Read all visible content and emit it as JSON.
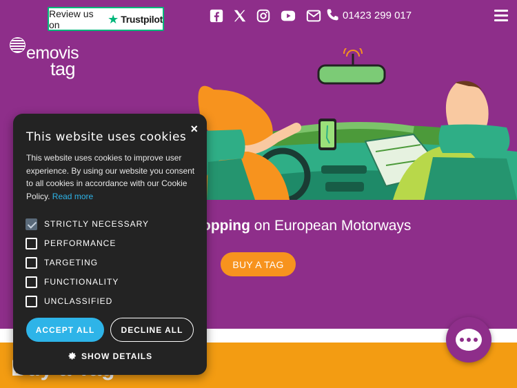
{
  "header": {
    "trustpilot": {
      "prefix": "Review us on",
      "brand": "Trustpilot"
    },
    "social_icons": [
      "facebook-icon",
      "x-icon",
      "instagram-icon",
      "youtube-icon",
      "email-icon"
    ],
    "phone": "01423 299 017"
  },
  "logo": {
    "line1": "emovis",
    "line2": "tag"
  },
  "hero": {
    "headline_bold": "topping",
    "headline_rest": " on European Motorways",
    "cta": "BUY A TAG"
  },
  "section": {
    "title": "Buy a Tag"
  },
  "cookie": {
    "title": "This website uses cookies",
    "description": "This website uses cookies to improve user experience. By using our website you consent to all cookies in accordance with our Cookie Policy.",
    "read_more": "Read more",
    "options": [
      {
        "label": "STRICTLY NECESSARY",
        "checked": true
      },
      {
        "label": "PERFORMANCE",
        "checked": false
      },
      {
        "label": "TARGETING",
        "checked": false
      },
      {
        "label": "FUNCTIONALITY",
        "checked": false
      },
      {
        "label": "UNCLASSIFIED",
        "checked": false
      }
    ],
    "accept": "ACCEPT ALL",
    "decline": "DECLINE ALL",
    "details": "SHOW DETAILS",
    "close": "×"
  },
  "colors": {
    "brand_purple": "#8e2e8a",
    "orange": "#f39c12",
    "accent_blue": "#2eb4e8",
    "trustpilot_green": "#00b67a"
  }
}
